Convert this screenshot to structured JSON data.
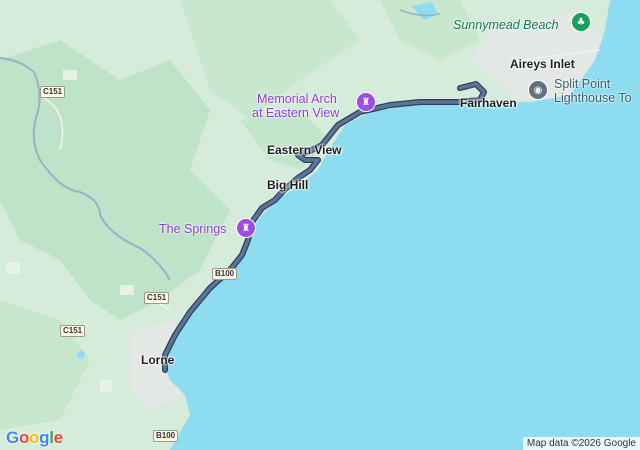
{
  "map": {
    "colors": {
      "land": "#d4ecd9",
      "forest": "#bfe3c8",
      "water": "#8edcef",
      "river": "#9ab0c4",
      "route": "#4f6685",
      "route_outline": "#2e3f5a",
      "town": "#e8eaec"
    },
    "places": {
      "sunnymead_beach": "Sunnymead Beach",
      "aireys_inlet": "Aireys Inlet",
      "split_point_line1": "Split Point",
      "split_point_line2": "Lighthouse To",
      "memorial_line1": "Memorial Arch",
      "memorial_line2": "at Eastern View",
      "fairhaven": "Fairhaven",
      "eastern_view": "Eastern View",
      "big_hill": "Big Hill",
      "the_springs": "The Springs",
      "lorne": "Lorne"
    },
    "road_shields": {
      "c151_top": "C151",
      "c151_mid": "C151",
      "c151_low": "C151",
      "b100_mid": "B100",
      "b100_bottom": "B100"
    },
    "icons": {
      "memorial": "monument-icon",
      "springs": "monument-icon",
      "lighthouse": "landmark-icon",
      "beach": "tree-icon"
    },
    "logo": "Google",
    "attribution": "Map data ©2026 Google"
  }
}
